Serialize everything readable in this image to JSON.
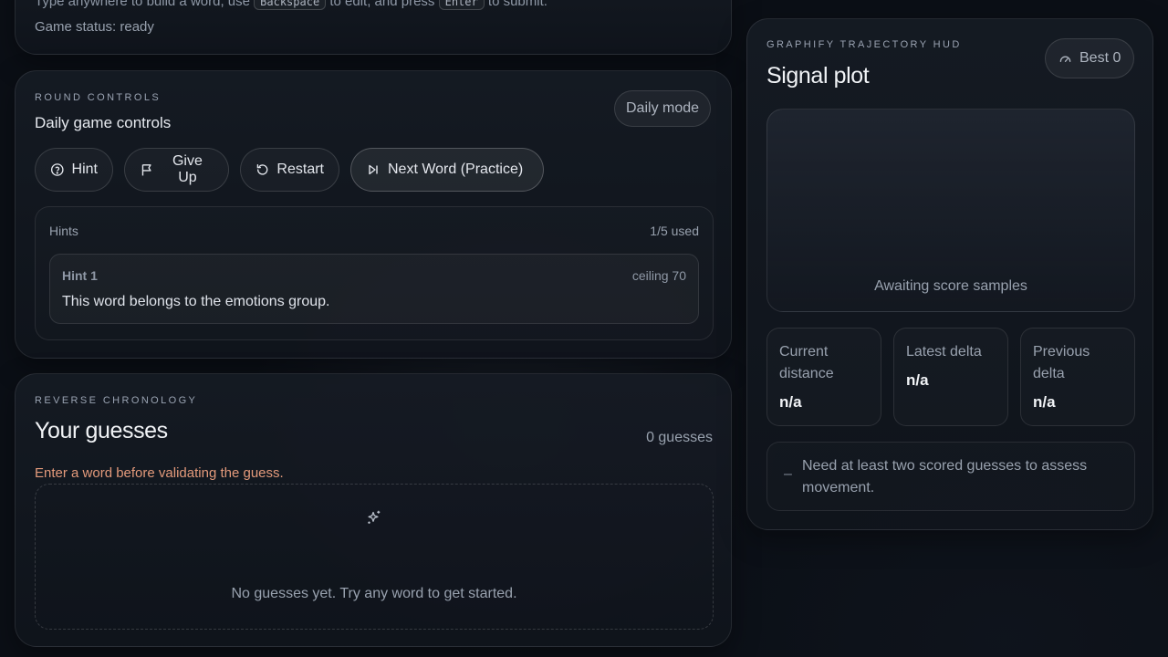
{
  "top_card": {
    "instructions_prefix": "Type anywhere to build a word, use",
    "key_backspace": "Backspace",
    "instructions_middle": "to edit, and press",
    "key_enter": "Enter",
    "instructions_suffix": "to submit.",
    "status": "Game status: ready"
  },
  "controls": {
    "eyebrow": "ROUND CONTROLS",
    "title": "Daily game controls",
    "mode_badge": "Daily mode",
    "buttons": {
      "hint": "Hint",
      "give_up": "Give Up",
      "restart": "Restart",
      "next_word": "Next Word (Practice)"
    },
    "hints": {
      "label": "Hints",
      "used": "1/5 used",
      "items": [
        {
          "title": "Hint 1",
          "ceiling": "ceiling 70",
          "text": "This word belongs to the emotions group."
        }
      ]
    }
  },
  "guesses": {
    "eyebrow": "REVERSE CHRONOLOGY",
    "title": "Your guesses",
    "count": "0 guesses",
    "error": "Enter a word before validating the guess.",
    "empty_icon": "sparkles-icon",
    "empty_text": "No guesses yet. Try any word to get started."
  },
  "hud": {
    "eyebrow": "GRAPHIFY TRAJECTORY HUD",
    "title": "Signal plot",
    "best": "Best 0",
    "best_icon": "gauge-icon",
    "plot_message": "Awaiting score samples",
    "stats": {
      "current_label": "Current distance",
      "current_value": "n/a",
      "latest_label": "Latest delta",
      "latest_value": "n/a",
      "previous_label": "Previous delta",
      "previous_value": "n/a"
    },
    "movement_dash": "–",
    "movement_text": "Need at least two scored guesses to assess movement."
  },
  "colors": {
    "background": "#0b0f16",
    "error": "#e39a7b",
    "text_primary": "#f1f3f6",
    "text_muted": "#98a1ae"
  }
}
